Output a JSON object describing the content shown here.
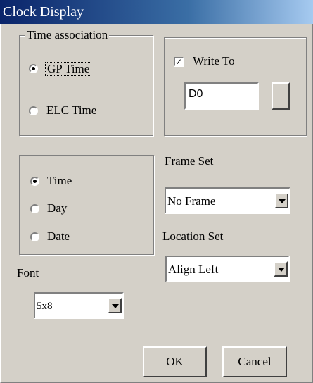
{
  "window": {
    "title": "Clock Display"
  },
  "time_association": {
    "legend": "Time association",
    "options": [
      {
        "label": "GP Time",
        "selected": true
      },
      {
        "label": "ELC Time",
        "selected": false
      }
    ]
  },
  "write_to": {
    "checkbox_label": "Write To",
    "checked": true,
    "address_value": "D0"
  },
  "display_mode": {
    "options": [
      {
        "label": "Time",
        "selected": true
      },
      {
        "label": "Day",
        "selected": false
      },
      {
        "label": "Date",
        "selected": false
      }
    ]
  },
  "frame_set": {
    "label": "Frame Set",
    "value": "No Frame"
  },
  "location_set": {
    "label": "Location Set",
    "value": "Align Left"
  },
  "font": {
    "label": "Font",
    "value": "5x8"
  },
  "buttons": {
    "ok": "OK",
    "cancel": "Cancel"
  }
}
